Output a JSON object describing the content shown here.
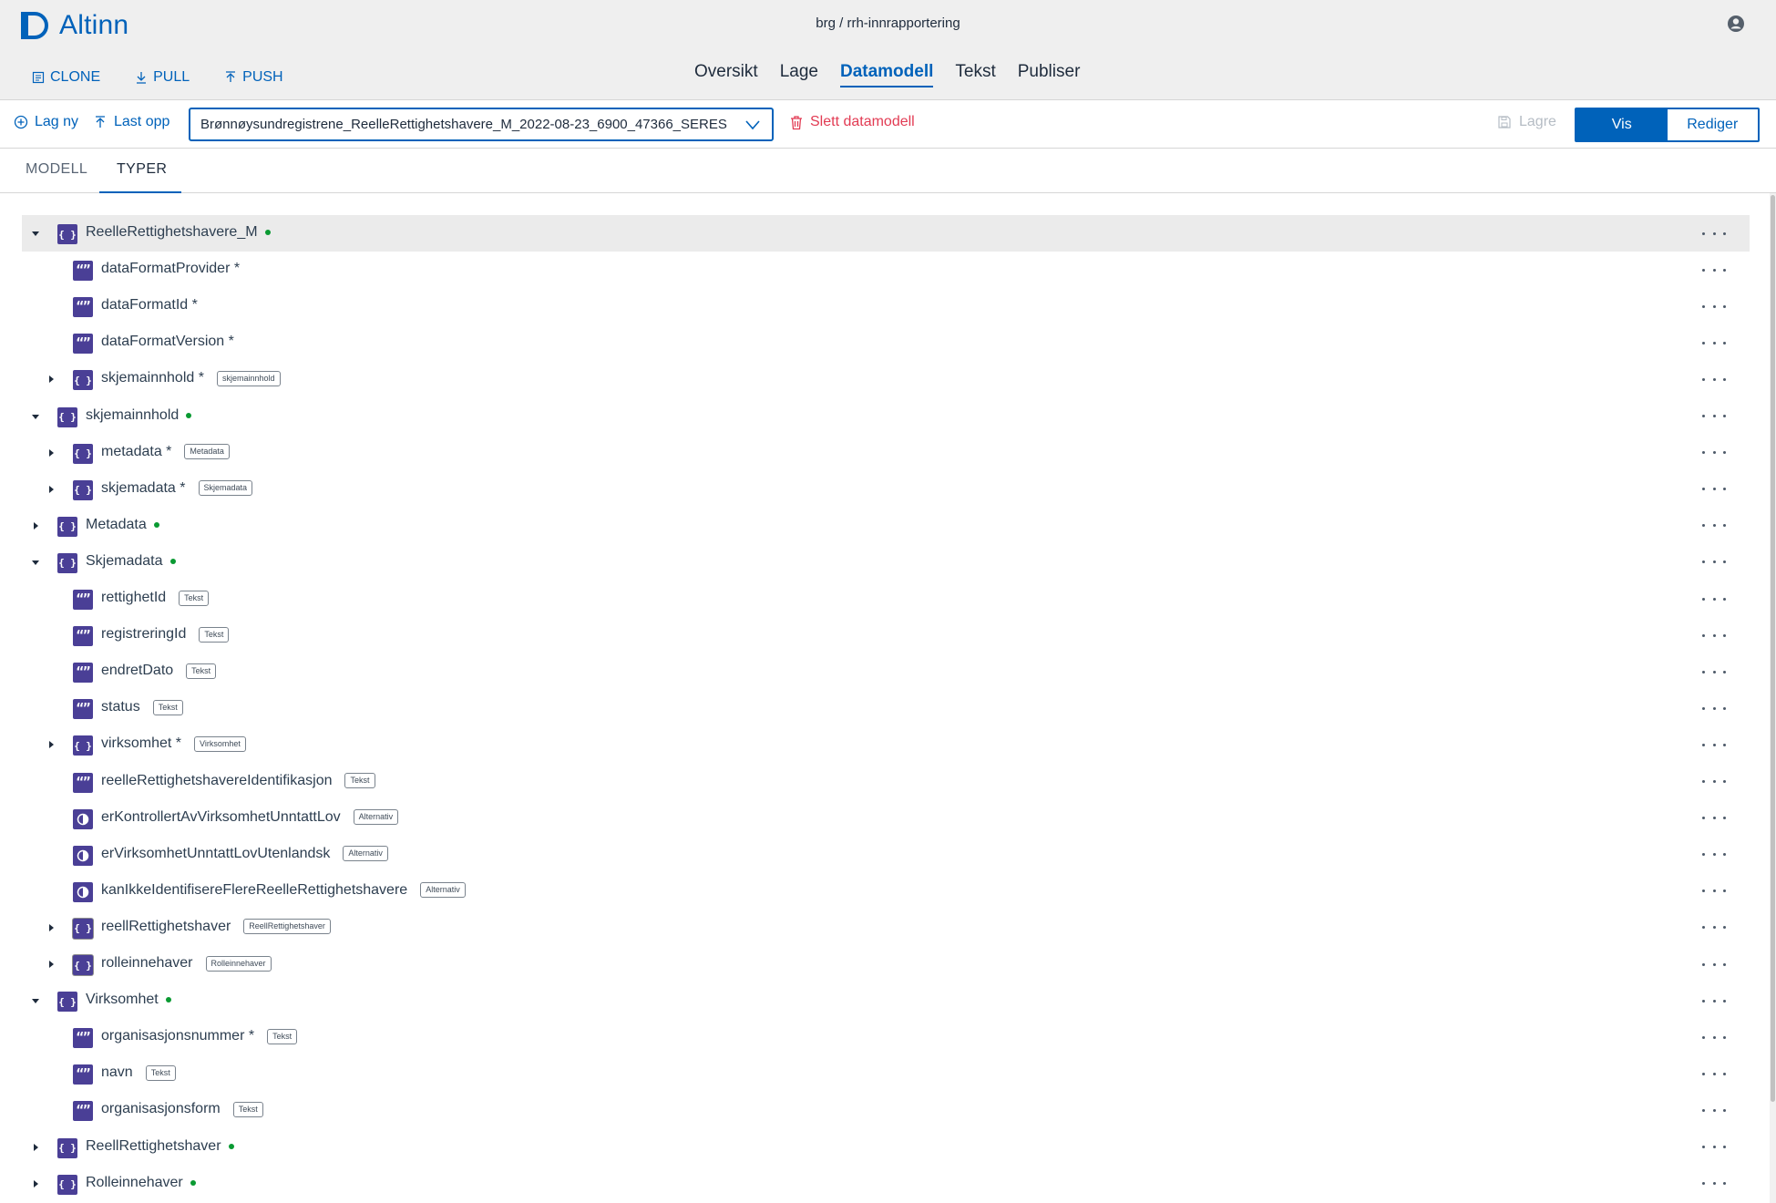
{
  "app": {
    "name": "Altinn",
    "repo_path": "brg / rrh-innrapportering"
  },
  "git_actions": [
    {
      "label": "CLONE",
      "icon": "clone-icon"
    },
    {
      "label": "PULL",
      "icon": "download-icon"
    },
    {
      "label": "PUSH",
      "icon": "upload-icon"
    }
  ],
  "nav": {
    "items": [
      "Oversikt",
      "Lage",
      "Datamodell",
      "Tekst",
      "Publiser"
    ],
    "active": "Datamodell"
  },
  "toolbar": {
    "create_label": "Lag ny",
    "upload_label": "Last opp",
    "selected_model": "Brønnøysundregistrene_ReelleRettighetshavere_M_2022-08-23_6900_47366_SERES",
    "delete_label": "Slett datamodell",
    "save_label": "Lagre",
    "view_label": "Vis",
    "edit_label": "Rediger",
    "mode": "Vis"
  },
  "tabs": {
    "items": [
      "MODELL",
      "TYPER"
    ],
    "active": "TYPER"
  },
  "colors": {
    "brand": "#0062ba",
    "type_icon": "#4a3f96",
    "delete": "#e23b53",
    "defined_dot": "#0a9a32"
  },
  "tree": [
    {
      "label": "ReelleRettighetshavere_M",
      "icon": "object-icon",
      "level": 0,
      "caret": "expanded",
      "dot": true,
      "selected": true
    },
    {
      "label": "dataFormatProvider *",
      "icon": "string-icon",
      "level": 1
    },
    {
      "label": "dataFormatId *",
      "icon": "string-icon",
      "level": 1
    },
    {
      "label": "dataFormatVersion *",
      "icon": "string-icon",
      "level": 1
    },
    {
      "label": "skjemainnhold *",
      "icon": "object-icon",
      "level": 1,
      "caret": "collapsed",
      "badge": "skjemainnhold"
    },
    {
      "label": "skjemainnhold",
      "icon": "object-icon",
      "level": 0,
      "caret": "expanded",
      "dot": true
    },
    {
      "label": "metadata *",
      "icon": "object-icon",
      "level": 1,
      "caret": "collapsed",
      "badge": "Metadata"
    },
    {
      "label": "skjemadata *",
      "icon": "object-icon",
      "level": 1,
      "caret": "collapsed",
      "badge": "Skjemadata"
    },
    {
      "label": "Metadata",
      "icon": "object-icon",
      "level": 0,
      "caret": "collapsed",
      "dot": true
    },
    {
      "label": "Skjemadata",
      "icon": "object-icon",
      "level": 0,
      "caret": "expanded",
      "dot": true
    },
    {
      "label": "rettighetId",
      "icon": "string-icon",
      "level": 1,
      "badge": "Tekst"
    },
    {
      "label": "registreringId",
      "icon": "string-icon",
      "level": 1,
      "badge": "Tekst"
    },
    {
      "label": "endretDato",
      "icon": "string-icon",
      "level": 1,
      "badge": "Tekst"
    },
    {
      "label": "status",
      "icon": "string-icon",
      "level": 1,
      "badge": "Tekst"
    },
    {
      "label": "virksomhet *",
      "icon": "object-icon",
      "level": 1,
      "caret": "collapsed",
      "badge": "Virksomhet"
    },
    {
      "label": "reelleRettighetshavereIdentifikasjon",
      "icon": "string-icon",
      "level": 1,
      "badge": "Tekst"
    },
    {
      "label": "erKontrollertAvVirksomhetUnntattLov",
      "icon": "boolean-icon",
      "level": 1,
      "badge": "Alternativ"
    },
    {
      "label": "erVirksomhetUnntattLovUtenlandsk",
      "icon": "boolean-icon",
      "level": 1,
      "badge": "Alternativ"
    },
    {
      "label": "kanIkkeIdentifisereFlereReelleRettighetshavere",
      "icon": "boolean-icon",
      "level": 1,
      "badge": "Alternativ"
    },
    {
      "label": "reellRettighetshaver",
      "icon": "array-object-icon",
      "level": 1,
      "caret": "collapsed",
      "badge": "ReellRettighetshaver"
    },
    {
      "label": "rolleinnehaver",
      "icon": "array-object-icon",
      "level": 1,
      "caret": "collapsed",
      "badge": "Rolleinnehaver"
    },
    {
      "label": "Virksomhet",
      "icon": "object-icon",
      "level": 0,
      "caret": "expanded",
      "dot": true
    },
    {
      "label": "organisasjonsnummer *",
      "icon": "string-icon",
      "level": 1,
      "badge": "Tekst"
    },
    {
      "label": "navn",
      "icon": "string-icon",
      "level": 1,
      "badge": "Tekst"
    },
    {
      "label": "organisasjonsform",
      "icon": "string-icon",
      "level": 1,
      "badge": "Tekst"
    },
    {
      "label": "ReellRettighetshaver",
      "icon": "object-icon",
      "level": 0,
      "caret": "collapsed",
      "dot": true
    },
    {
      "label": "Rolleinnehaver",
      "icon": "object-icon",
      "level": 0,
      "caret": "collapsed",
      "dot": true
    }
  ]
}
